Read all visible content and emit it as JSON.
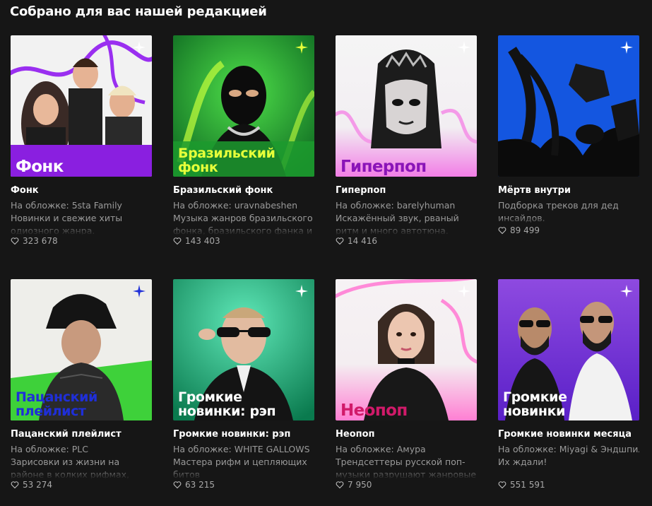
{
  "section": {
    "title": "Собрано для вас нашей редакцией"
  },
  "playlists": [
    {
      "cover_title": "Фонк",
      "name": "Фонк",
      "cover_caption": "На обложке: 5sta Family",
      "description": "Новинки и свежие хиты одиозного жанра.",
      "likes": "323 678",
      "cover_bg": "#f1f1f1",
      "band_color": "#8a1fe0",
      "title_color": "#ffffff"
    },
    {
      "cover_title": "Бразильский\nфонк",
      "name": "Бразильский фонк",
      "cover_caption": "На обложке: uravnabeshen",
      "description": "Музыка жанров бразильского фонка, бразильского фанка и",
      "likes": "143 403",
      "cover_bg": "#1a7a2a",
      "band_color": "#1c9a2e",
      "title_color": "#e6ff3a"
    },
    {
      "cover_title": "Гиперпоп",
      "name": "Гиперпоп",
      "cover_caption": "На обложке: barelyhuman",
      "description": "Искажённый звук, рваный ритм и много автотюна.",
      "likes": "14 416",
      "cover_bg": "#f3eef3",
      "band_color": "#f27ee6",
      "title_color": "#8a14b8"
    },
    {
      "cover_title": "",
      "name": "Мёртв внутри",
      "cover_caption": "",
      "description": "Подборка треков для дед инсайдов.",
      "likes": "89 499",
      "cover_bg": "#1456e0",
      "band_color": "#1456e0",
      "title_color": "#ffffff"
    },
    {
      "cover_title": "Пацанский\nплейлист",
      "name": "Пацанский плейлист",
      "cover_caption": "На обложке: PLC",
      "description": "Зарисовки из жизни на районе в колких рифмах, душевных",
      "likes": "53 274",
      "cover_bg": "#eeeeea",
      "band_color": "#3ed13a",
      "title_color": "#1f2fd8"
    },
    {
      "cover_title": "Громкие\nновинки: рэп",
      "name": "Громкие новинки: рэп",
      "cover_caption": "На обложке: WHITE GALLOWS",
      "description": "Мастера рифм и цепляющих битов",
      "likes": "63 215",
      "cover_bg": "#12a36f",
      "band_color": "#0c8f5c",
      "title_color": "#ffffff"
    },
    {
      "cover_title": "Неопоп",
      "name": "Неопоп",
      "cover_caption": "На обложке: Амура",
      "description": "Трендсеттеры русской поп-музыки разрушают жанровые",
      "likes": "7 950",
      "cover_bg": "#f4eef1",
      "band_color": "#ff7fd3",
      "title_color": "#d11a6a"
    },
    {
      "cover_title": "Громкие\nновинки",
      "name": "Громкие новинки месяца",
      "cover_caption": "На обложке: Miyagi & Эндшпиль",
      "description": "Их ждали!",
      "likes": "551 591",
      "cover_bg": "#7a3ad8",
      "band_color": "#7c2ff0",
      "title_color": "#ffffff"
    }
  ]
}
